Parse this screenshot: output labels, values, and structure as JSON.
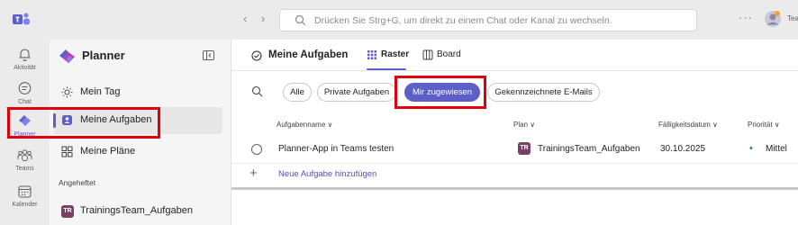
{
  "topbar": {
    "search_placeholder": "Drücken Sie Strg+G, um direkt zu einem Chat oder Kanal zu wechseln.",
    "back_icon": "chevron-left-icon",
    "forward_icon": "chevron-right-icon",
    "more_label": "···",
    "user_short": "Tea"
  },
  "rail": {
    "items": [
      {
        "label": "Aktivität",
        "icon": "bell-icon"
      },
      {
        "label": "Chat",
        "icon": "chat-icon"
      },
      {
        "label": "Planner",
        "icon": "planner-icon"
      },
      {
        "label": "Teams",
        "icon": "teams-icon"
      },
      {
        "label": "Kalender",
        "icon": "calendar-icon"
      }
    ]
  },
  "sidebar": {
    "title": "Planner",
    "items": [
      {
        "label": "Mein Tag",
        "icon": "sun-icon"
      },
      {
        "label": "Meine Aufgaben",
        "icon": "my-tasks-icon"
      },
      {
        "label": "Meine Pläne",
        "icon": "grid-icon"
      }
    ],
    "pinned_heading": "Angeheftet",
    "pinned": [
      {
        "badge": "TR",
        "label": "TrainingsTeam_Aufgaben"
      }
    ]
  },
  "main": {
    "title": "Meine Aufgaben",
    "tabs": [
      {
        "label": "Raster",
        "active": true
      },
      {
        "label": "Board",
        "active": false
      }
    ],
    "filters": [
      {
        "label": "Alle",
        "active": false
      },
      {
        "label": "Private Aufgaben",
        "active": false
      },
      {
        "label": "Mir zugewiesen",
        "active": true
      },
      {
        "label": "Gekennzeichnete E-Mails",
        "active": false
      }
    ],
    "columns": {
      "name": "Aufgabenname ∨",
      "plan": "Plan ∨",
      "due": "Fälligkeitsdatum ∨",
      "priority": "Priorität ∨"
    },
    "tasks": [
      {
        "title": "Planner-App in Teams testen",
        "plan_badge": "TR",
        "plan": "TrainingsTeam_Aufgaben",
        "due": "30.10.2025",
        "priority": "Mittel"
      }
    ],
    "add_task": "Neue Aufgabe hinzufügen"
  },
  "colors": {
    "accent": "#5b5fc7",
    "highlight": "#e0000c",
    "plan_badge": "#7b3f63"
  }
}
